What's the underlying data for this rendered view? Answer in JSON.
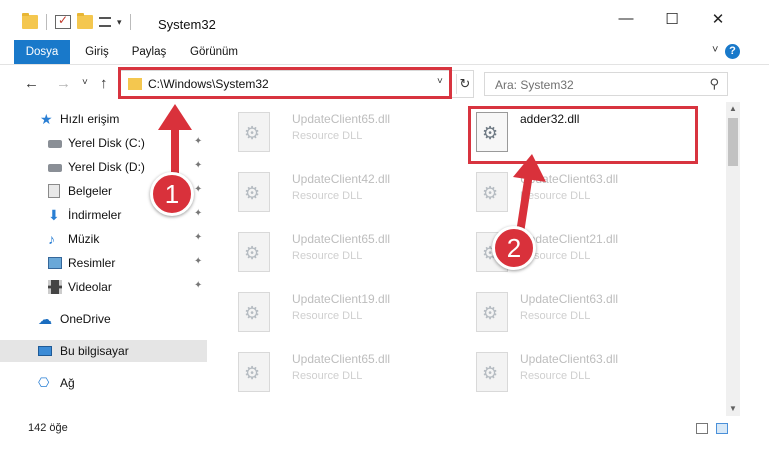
{
  "window": {
    "title": "System32",
    "minimize_glyph": "—",
    "maximize_glyph": "☐",
    "close_glyph": "✕"
  },
  "ribbon": {
    "tabs": [
      "Dosya",
      "Giriş",
      "Paylaş",
      "Görünüm"
    ],
    "expand_glyph": "˅",
    "help_glyph": "?"
  },
  "address": {
    "path": "C:\\Windows\\System32",
    "back_glyph": "←",
    "forward_glyph": "→",
    "recent_glyph": "˅",
    "up_glyph": "↑",
    "dropdown_glyph": "˅",
    "refresh_glyph": "↻"
  },
  "search": {
    "placeholder": "Ara: System32",
    "icon_glyph": "⚲"
  },
  "nav": {
    "quick_access": "Hızlı erişim",
    "items": [
      {
        "label": "Yerel Disk (C:)",
        "icon": "drive-icon"
      },
      {
        "label": "Yerel Disk (D:)",
        "icon": "drive-icon"
      },
      {
        "label": "Belgeler",
        "icon": "documents-icon"
      },
      {
        "label": "İndirmeler",
        "icon": "downloads-icon"
      },
      {
        "label": "Müzik",
        "icon": "music-icon"
      },
      {
        "label": "Resimler",
        "icon": "pictures-icon"
      },
      {
        "label": "Videolar",
        "icon": "videos-icon"
      }
    ],
    "pin_glyph": "📌",
    "onedrive": "OneDrive",
    "this_pc": "Bu bilgisayar",
    "network": "Ağ"
  },
  "files": {
    "left_column": [
      {
        "name": "UpdateClient65.dll",
        "type": "Resource DLL"
      },
      {
        "name": "UpdateClient42.dll",
        "type": "Resource DLL"
      },
      {
        "name": "UpdateClient65.dll",
        "type": "Resource DLL"
      },
      {
        "name": "UpdateClient19.dll",
        "type": "Resource DLL"
      },
      {
        "name": "UpdateClient65.dll",
        "type": "Resource DLL"
      }
    ],
    "right_column": [
      {
        "name": "adder32.dll",
        "type": ""
      },
      {
        "name": "UpdateClient63.dll",
        "type": "Resource DLL"
      },
      {
        "name": "UpdateClient21.dll",
        "type": "Resource DLL"
      },
      {
        "name": "UpdateClient63.dll",
        "type": "Resource DLL"
      },
      {
        "name": "UpdateClient63.dll",
        "type": "Resource DLL"
      }
    ]
  },
  "status": {
    "item_count": "142 öğe"
  },
  "annotations": {
    "step1": "1",
    "step2": "2",
    "highlight_color": "#d8343f"
  }
}
